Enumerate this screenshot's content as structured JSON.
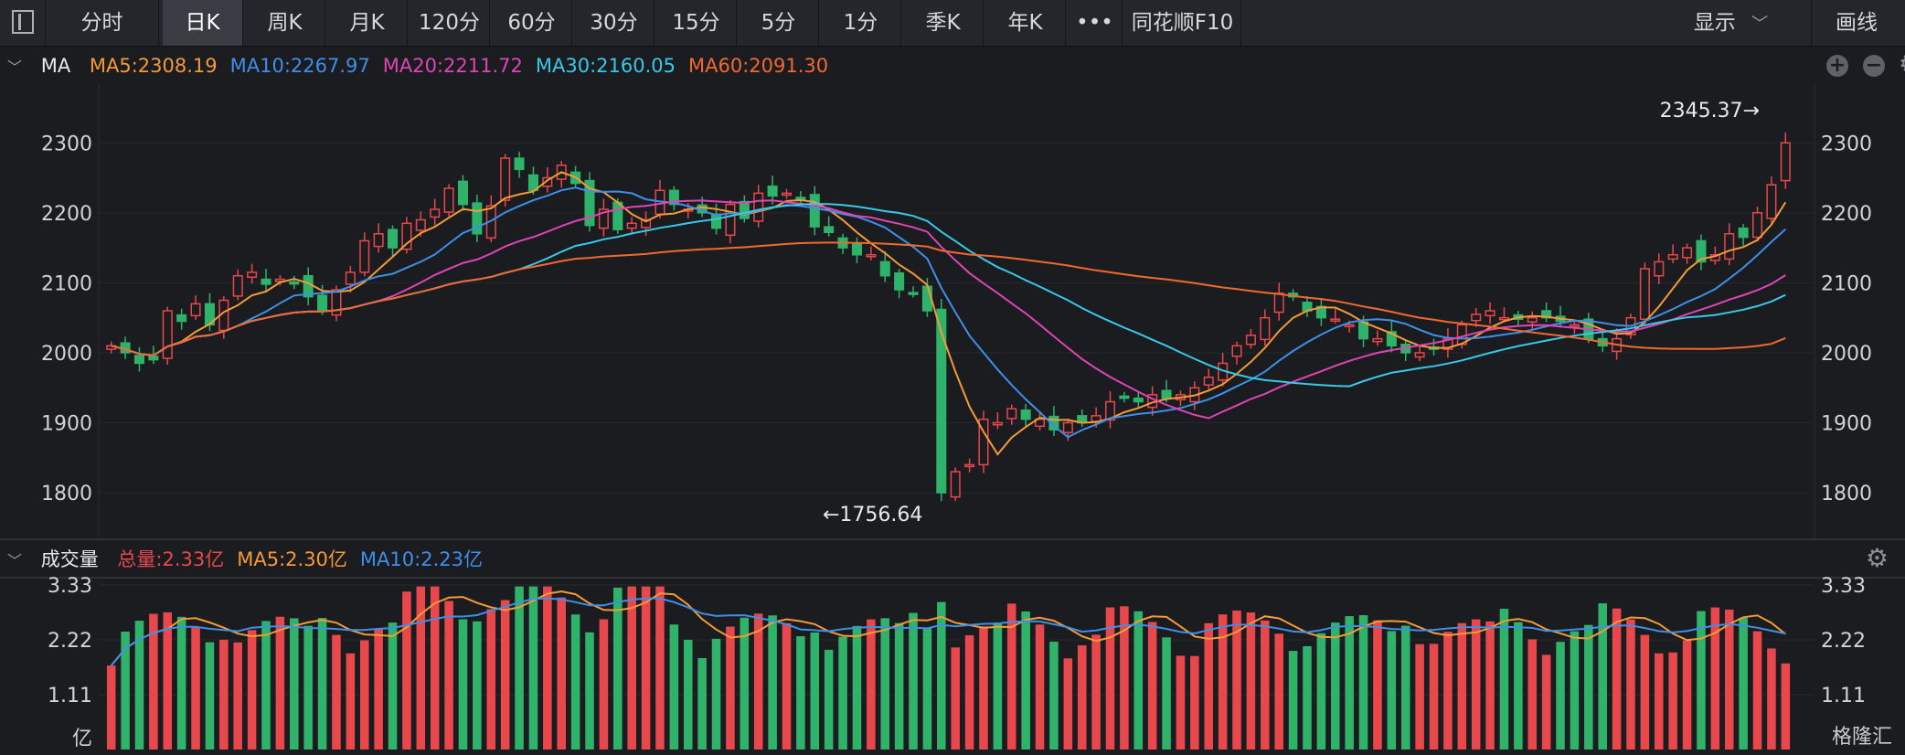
{
  "toolbar": {
    "tabs": [
      "分时",
      "日K",
      "周K",
      "月K",
      "120分",
      "60分",
      "30分",
      "15分",
      "5分",
      "1分",
      "季K",
      "年K",
      "•••",
      "同花顺F10"
    ],
    "active_tab": "日K",
    "display_label": "显示",
    "draw_label": "画线"
  },
  "price_legend": {
    "title": "MA",
    "items": [
      {
        "label": "MA5:2308.19",
        "color": "#f39a38"
      },
      {
        "label": "MA10:2267.97",
        "color": "#3d8fe8"
      },
      {
        "label": "MA20:2211.72",
        "color": "#de45b4"
      },
      {
        "label": "MA30:2160.05",
        "color": "#38c8e8"
      },
      {
        "label": "MA60:2091.30",
        "color": "#f06a30"
      }
    ]
  },
  "volume_legend": {
    "title": "成交量",
    "items": [
      {
        "label": "总量:2.33亿",
        "color": "#e8474c"
      },
      {
        "label": "MA5:2.30亿",
        "color": "#f39a38"
      },
      {
        "label": "MA10:2.23亿",
        "color": "#3d8fe8"
      }
    ]
  },
  "watermark": "格隆汇",
  "chart_data": [
    {
      "type": "candlestick",
      "title": "MA",
      "y_ticks": [
        2300,
        2200,
        2100,
        2000,
        1900,
        1800
      ],
      "ylim": [
        1740,
        2380
      ],
      "annotations": [
        {
          "label": "2345.37→",
          "index": 118,
          "value": 2345.37
        },
        {
          "label": "←1756.64",
          "index": 49,
          "value": 1756.64
        }
      ],
      "candles": [
        [
          2010,
          2015,
          1985,
          2020
        ],
        [
          2005,
          2000,
          1990,
          2015
        ],
        [
          2000,
          1975,
          1965,
          2012
        ],
        [
          1970,
          1985,
          1955,
          1995
        ],
        [
          1990,
          2065,
          1985,
          2075
        ],
        [
          2050,
          2040,
          2030,
          2058
        ],
        [
          2040,
          2070,
          2030,
          2078
        ],
        [
          2055,
          2035,
          2022,
          2065
        ],
        [
          2040,
          2075,
          2032,
          2080
        ],
        [
          2090,
          2110,
          2080,
          2120
        ],
        [
          2110,
          2115,
          2100,
          2125
        ],
        [
          2105,
          2098,
          2085,
          2112
        ],
        [
          2095,
          2105,
          2085,
          2110
        ],
        [
          2110,
          2100,
          2090,
          2130
        ],
        [
          2100,
          2075,
          2065,
          2108
        ],
        [
          2095,
          2060,
          2048,
          2105
        ],
        [
          2060,
          2090,
          2055,
          2100
        ],
        [
          2095,
          2115,
          2085,
          2122
        ],
        [
          2110,
          2160,
          2100,
          2172
        ],
        [
          2170,
          2170,
          2160,
          2185
        ],
        [
          2160,
          2145,
          2135,
          2175
        ],
        [
          2140,
          2185,
          2135,
          2192
        ],
        [
          2180,
          2190,
          2170,
          2198
        ],
        [
          2195,
          2205,
          2185,
          2212
        ],
        [
          2215,
          2235,
          2205,
          2242
        ],
        [
          2220,
          2210,
          2200,
          2230
        ],
        [
          2215,
          2165,
          2160,
          2220
        ],
        [
          2170,
          2210,
          2160,
          2215
        ],
        [
          2210,
          2280,
          2205,
          2285
        ],
        [
          2275,
          2260,
          2250,
          2285
        ],
        [
          2255,
          2230,
          2220,
          2262
        ],
        [
          2235,
          2250,
          2225,
          2258
        ],
        [
          2255,
          2270,
          2245,
          2278
        ],
        [
          2275,
          2240,
          2230,
          2282
        ],
        [
          2240,
          2180,
          2170,
          2245
        ],
        [
          2180,
          2205,
          2172,
          2210
        ],
        [
          2195,
          2175,
          2165,
          2200
        ],
        [
          2170,
          2185,
          2160,
          2190
        ],
        [
          2180,
          2190,
          2175,
          2200
        ],
        [
          2195,
          2235,
          2190,
          2242
        ],
        [
          2225,
          2210,
          2200,
          2232
        ],
        [
          2210,
          2205,
          2198,
          2218
        ],
        [
          2205,
          2200,
          2190,
          2215
        ],
        [
          2205,
          2175,
          2165,
          2210
        ],
        [
          2185,
          2215,
          2175,
          2222
        ],
        [
          2200,
          2190,
          2180,
          2210
        ],
        [
          2190,
          2230,
          2185,
          2235
        ],
        [
          2230,
          2225,
          2218,
          2240
        ],
        [
          2225,
          2230,
          2215,
          2238
        ],
        [
          2215,
          2220,
          2210,
          2225
        ]
      ]
    },
    {
      "type": "bar",
      "title": "成交量",
      "unit": "亿",
      "y_ticks": [
        3.33,
        2.22,
        1.11
      ],
      "ylim": [
        0,
        3.33
      ]
    }
  ]
}
